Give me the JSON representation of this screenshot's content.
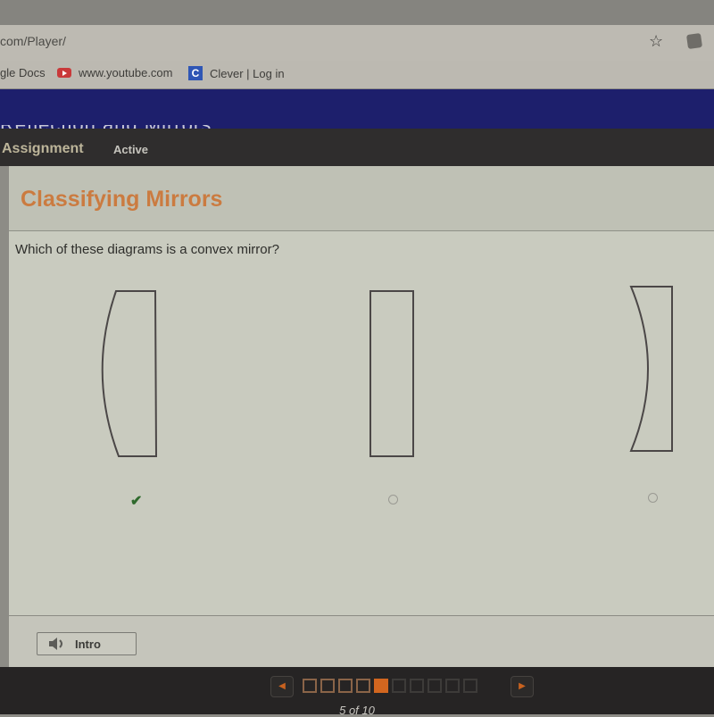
{
  "browser": {
    "url": "com/Player/",
    "bookmarks": [
      {
        "label": "gle Docs",
        "icon": "google-docs-icon"
      },
      {
        "label": "www.youtube.com",
        "icon": "youtube-icon"
      },
      {
        "label": "Clever | Log in",
        "icon": "clever-icon",
        "icon_glyph": "C"
      }
    ]
  },
  "header": {
    "partial_title": "Reflection and Mirrors",
    "section": "Assignment",
    "status": "Active"
  },
  "activity": {
    "title": "Classifying Mirrors",
    "question": "Which of these diagrams is a convex mirror?",
    "options": [
      {
        "shape": "convex",
        "state": "correct"
      },
      {
        "shape": "plane",
        "state": "unselected"
      },
      {
        "shape": "concave",
        "state": "unselected"
      }
    ],
    "check_glyph": "✔"
  },
  "footer": {
    "intro_label": "Intro"
  },
  "pager": {
    "current": 5,
    "total": 10,
    "counter_text": "5 of 10",
    "prev_glyph": "◀",
    "next_glyph": "▶"
  },
  "colors": {
    "accent": "#d2661f",
    "title": "#cb7b40",
    "header_blue": "#1d1f6c",
    "correct": "#2f6a2d"
  }
}
